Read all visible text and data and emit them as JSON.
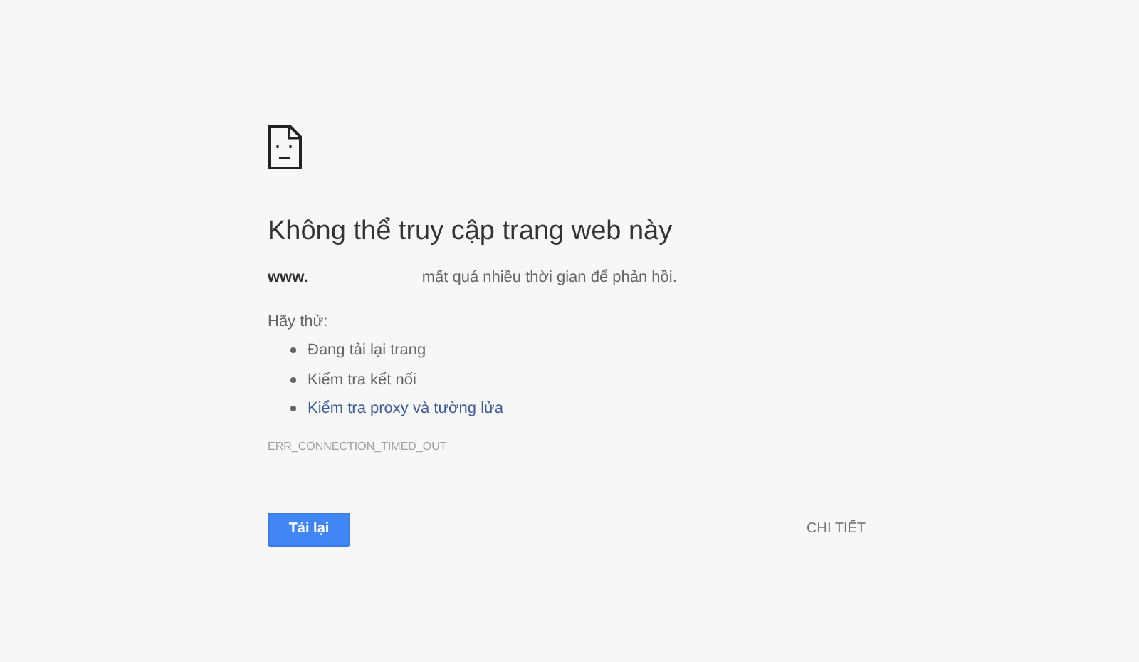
{
  "title": "Không thể truy cập trang web này",
  "message": {
    "host": "www.",
    "text": "mất quá nhiều thời gian để phản hồi."
  },
  "suggestions_heading": "Hãy thử:",
  "suggestions": [
    {
      "kind": "text",
      "label": "Đang tải lại trang"
    },
    {
      "kind": "text",
      "label": "Kiểm tra kết nối"
    },
    {
      "kind": "link",
      "label": "Kiểm tra proxy và tường lửa"
    }
  ],
  "error_code": "ERR_CONNECTION_TIMED_OUT",
  "reload_button": "Tải lại",
  "details_button": "CHI TIẾT"
}
